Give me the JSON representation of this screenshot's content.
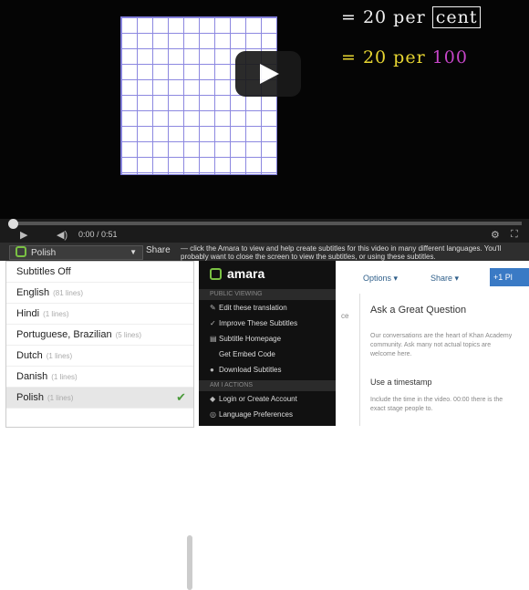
{
  "video": {
    "line1_prefix": "= 20 per ",
    "line1_boxed": "cent",
    "line2_eq": "= 20 per ",
    "line2_num": "100",
    "time": "0:00 / 0:51"
  },
  "amara_bar": {
    "language": "Polish",
    "share": "Share",
    "promo": "— click the Amara to view and help create subtitles for this video in many different languages. You'll probably want to close the screen to view the subtitles, or using these subtitles."
  },
  "languages": [
    {
      "label": "Subtitles Off",
      "count": ""
    },
    {
      "label": "English",
      "count": "(81 lines)"
    },
    {
      "label": "Hindi",
      "count": "(1 lines)"
    },
    {
      "label": "Portuguese, Brazilian",
      "count": "(5 lines)"
    },
    {
      "label": "Dutch",
      "count": "(1 lines)"
    },
    {
      "label": "Danish",
      "count": "(1 lines)"
    },
    {
      "label": "Polish",
      "count": "(1 lines)",
      "selected": true,
      "check": "✔"
    }
  ],
  "amara_menu": {
    "brand": "amara",
    "section1": "PUBLIC VIEWING",
    "items1": [
      {
        "icon": "pencil-icon",
        "glyph": "✎",
        "label": "Edit these translation"
      },
      {
        "icon": "wand-icon",
        "glyph": "✓",
        "label": "Improve These Subtitles"
      },
      {
        "icon": "page-icon",
        "glyph": "▤",
        "label": "Subtitle Homepage"
      },
      {
        "icon": "code-icon",
        "glyph": "",
        "label": "Get Embed Code"
      },
      {
        "icon": "download-icon",
        "glyph": "●",
        "label": "Download Subtitles"
      }
    ],
    "section2": "AM I ACTIONS",
    "items2": [
      {
        "icon": "user-icon",
        "glyph": "◆",
        "label": "Login or Create Account"
      },
      {
        "icon": "globe-icon",
        "glyph": "◎",
        "label": "Language Preferences"
      }
    ]
  },
  "right_panel": {
    "options": "Options ▾",
    "share": "Share ▾",
    "plus": "+1 Pl",
    "fragment": "ce",
    "question_title": "Ask a Great Question",
    "body1": "Our conversations are the heart of Khan Academy community. Ask many not actual topics are welcome here.",
    "heading2": "Use a timestamp",
    "body2": "Include the time in the video. 00:00 there is the exact stage people to."
  },
  "colors": {
    "accent_green": "#7ac143",
    "pen_yellow": "#e8d632",
    "pen_purple": "#c645c8",
    "button_blue": "#3a7ac5"
  }
}
